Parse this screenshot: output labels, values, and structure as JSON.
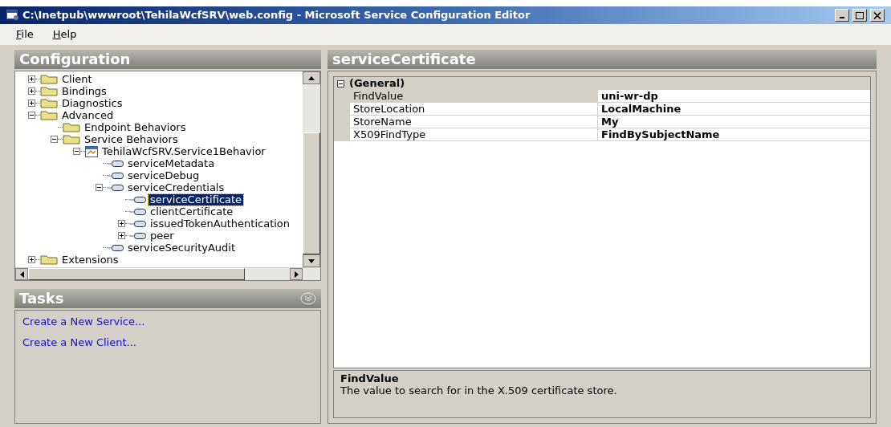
{
  "window": {
    "title": "C:\\Inetpub\\wwwroot\\TehilaWcfSRV\\web.config - Microsoft Service Configuration Editor"
  },
  "menu": [
    {
      "label": "File"
    },
    {
      "label": "Help"
    }
  ],
  "configuration": {
    "title": "Configuration",
    "tree": [
      {
        "label": "Client",
        "kind": "folder",
        "expanded": false,
        "selected": false
      },
      {
        "label": "Bindings",
        "kind": "folder",
        "expanded": false,
        "selected": false
      },
      {
        "label": "Diagnostics",
        "kind": "folder",
        "expanded": false,
        "selected": false
      },
      {
        "label": "Advanced",
        "kind": "folder",
        "expanded": true,
        "selected": false,
        "children": [
          {
            "label": "Endpoint Behaviors",
            "kind": "folder",
            "selected": false
          },
          {
            "label": "Service Behaviors",
            "kind": "folder",
            "expanded": true,
            "selected": false,
            "children": [
              {
                "label": "TehilaWcfSRV.Service1Behavior",
                "kind": "behavior",
                "expanded": true,
                "selected": false,
                "children": [
                  {
                    "label": "serviceMetadata",
                    "kind": "element",
                    "selected": false
                  },
                  {
                    "label": "serviceDebug",
                    "kind": "element",
                    "selected": false
                  },
                  {
                    "label": "serviceCredentials",
                    "kind": "element",
                    "expanded": true,
                    "selected": false,
                    "children": [
                      {
                        "label": "serviceCertificate",
                        "kind": "element",
                        "selected": true
                      },
                      {
                        "label": "clientCertificate",
                        "kind": "element",
                        "selected": false
                      },
                      {
                        "label": "issuedTokenAuthentication",
                        "kind": "element",
                        "expanded": false,
                        "selected": false
                      },
                      {
                        "label": "peer",
                        "kind": "element",
                        "expanded": false,
                        "selected": false
                      }
                    ]
                  },
                  {
                    "label": "serviceSecurityAudit",
                    "kind": "element",
                    "selected": false
                  }
                ]
              }
            ]
          }
        ]
      },
      {
        "label": "Extensions",
        "kind": "folder",
        "expanded": false,
        "selected": false
      }
    ]
  },
  "tasks": {
    "title": "Tasks",
    "links": [
      "Create a New Service...",
      "Create a New Client..."
    ]
  },
  "properties": {
    "title": "serviceCertificate",
    "category": {
      "label": "(General)",
      "expanded": true
    },
    "rows": [
      {
        "name": "FindValue",
        "value": "uni-wr-dp",
        "selected": true
      },
      {
        "name": "StoreLocation",
        "value": "LocalMachine",
        "selected": false
      },
      {
        "name": "StoreName",
        "value": "My",
        "selected": false
      },
      {
        "name": "X509FindType",
        "value": "FindBySubjectName",
        "selected": false
      }
    ],
    "description": {
      "title": "FindValue",
      "text": "The value to search for in the X.509 certificate store."
    }
  }
}
